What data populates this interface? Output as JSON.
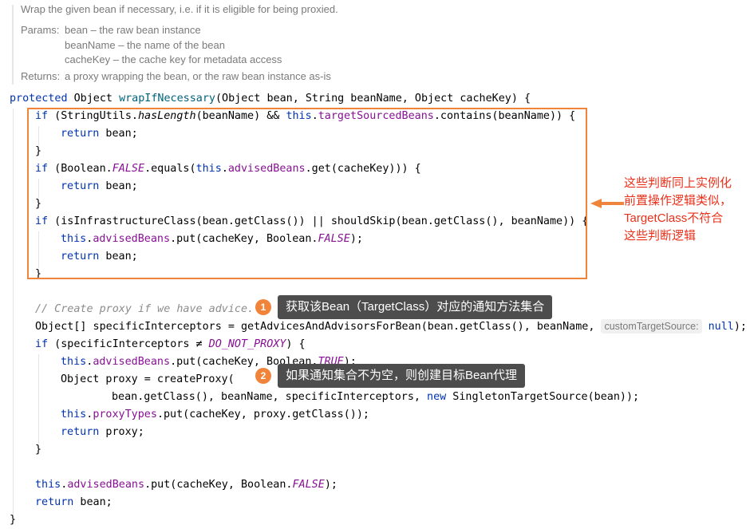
{
  "javadoc": {
    "summary": "Wrap the given bean if necessary, i.e. if it is eligible for being proxied.",
    "params_label": "Params:",
    "params": [
      "bean – the raw bean instance",
      "beanName – the name of the bean",
      "cacheKey – the cache key for metadata access"
    ],
    "returns_label": "Returns:",
    "returns": "a proxy wrapping the bean, or the raw bean instance as-is"
  },
  "code": {
    "l1": {
      "kw": "protected",
      "t1": " Object ",
      "fn": "wrapIfNecessary",
      "t2": "(Object bean, String beanName, Object cacheKey) {"
    },
    "l2": {
      "kw": "if",
      "t1": " (StringUtils.",
      "m": "hasLength",
      "t2": "(beanName) && ",
      "kw2": "this",
      "t3": ".",
      "f": "targetSourcedBeans",
      "t4": ".contains(beanName)) {"
    },
    "l3": {
      "kw": "return",
      "t1": " bean;"
    },
    "l4": "}",
    "l5": {
      "kw": "if",
      "t1": " (Boolean.",
      "c": "FALSE",
      "t2": ".equals(",
      "kw2": "this",
      "t3": ".",
      "f": "advisedBeans",
      "t4": ".get(cacheKey))) {"
    },
    "l6": {
      "kw": "return",
      "t1": " bean;"
    },
    "l7": "}",
    "l8": {
      "kw": "if",
      "t1": " (isInfrastructureClass(bean.getClass()) || shouldSkip(bean.getClass(), beanName)) {"
    },
    "l9": {
      "kw": "this",
      "t1": ".",
      "f": "advisedBeans",
      "t2": ".put(cacheKey, Boolean.",
      "c": "FALSE",
      "t3": ");"
    },
    "l10": {
      "kw": "return",
      "t1": " bean;"
    },
    "l11": "}",
    "l12": "// Create proxy if we have advice.",
    "l13": {
      "t1": "Object[] specificInterceptors = getAdvicesAndAdvisorsForBean(bean.getClass(), beanName, ",
      "hint": "customTargetSource:",
      "kw": "null",
      "t2": ");"
    },
    "l14": {
      "kw": "if",
      "t1": " (specificInterceptors ≠ ",
      "c": "DO_NOT_PROXY",
      "t2": ") {"
    },
    "l15": {
      "kw": "this",
      "t1": ".",
      "f": "advisedBeans",
      "t2": ".put(cacheKey, Boolean.",
      "c": "TRUE",
      "t3": ");"
    },
    "l16": {
      "t1": "Object proxy = createProxy("
    },
    "l17": {
      "t1": "bean.getClass(), beanName, specificInterceptors, ",
      "kw": "new",
      "t2": " SingletonTargetSource(bean));"
    },
    "l18": {
      "kw": "this",
      "t1": ".",
      "f": "proxyTypes",
      "t2": ".put(cacheKey, proxy.getClass());"
    },
    "l19": {
      "kw": "return",
      "t1": " proxy;"
    },
    "l20": "}",
    "l21": {
      "kw": "this",
      "t1": ".",
      "f": "advisedBeans",
      "t2": ".put(cacheKey, Boolean.",
      "c": "FALSE",
      "t3": ");"
    },
    "l22": {
      "kw": "return",
      "t1": " bean;"
    },
    "l23": "}"
  },
  "annotations": {
    "box_note": [
      "这些判断同上实例化",
      "前置操作逻辑类似，",
      "TargetClass不符合",
      "这些判断逻辑"
    ],
    "tip1": {
      "badge": "1",
      "text": "获取该Bean（TargetClass）对应的通知方法集合"
    },
    "tip2": {
      "badge": "2",
      "text": "如果通知集合不为空，则创建目标Bean代理"
    }
  },
  "colors": {
    "accent_orange": "#f0843a",
    "note_red": "#e8311b",
    "keyword": "#0033b3",
    "field": "#871094"
  }
}
